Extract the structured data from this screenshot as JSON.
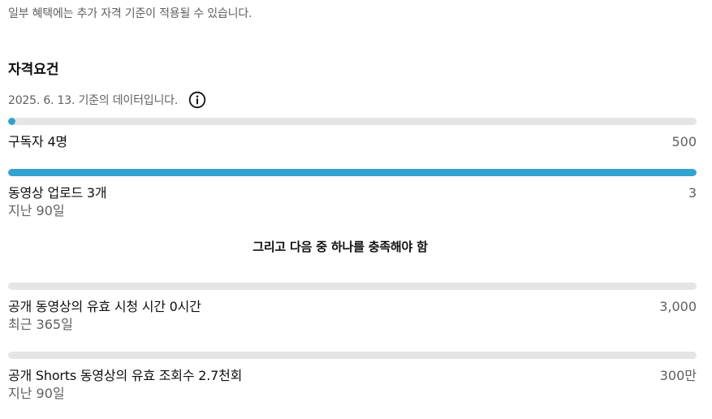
{
  "notice": "일부 혜택에는 추가 자격 기준이 적용될 수 있습니다.",
  "section_title": "자격요건",
  "data_date": "2025. 6. 13. 기준의 데이터입니다.",
  "info_icon": "info-circle-icon",
  "colors": {
    "progress_fill": "#32a3cf",
    "progress_track": "#e5e5e5",
    "secondary_text": "#606060"
  },
  "requirements": [
    {
      "label": "구독자 4명",
      "target": "500",
      "sub": "",
      "progress": 0.008
    },
    {
      "label": "동영상 업로드 3개",
      "target": "3",
      "sub": "지난 90일",
      "progress": 1.0
    }
  ],
  "or_text": "그리고 다음 중 하나를 충족해야 함",
  "alternatives": [
    {
      "label": "공개 동영상의 유효 시청 시간 0시간",
      "target": "3,000",
      "sub": "최근 365일",
      "progress": 0
    },
    {
      "label": "공개 Shorts 동영상의 유효 조회수 2.7천회",
      "target": "300만",
      "sub": "지난 90일",
      "progress": 0.0009
    }
  ]
}
